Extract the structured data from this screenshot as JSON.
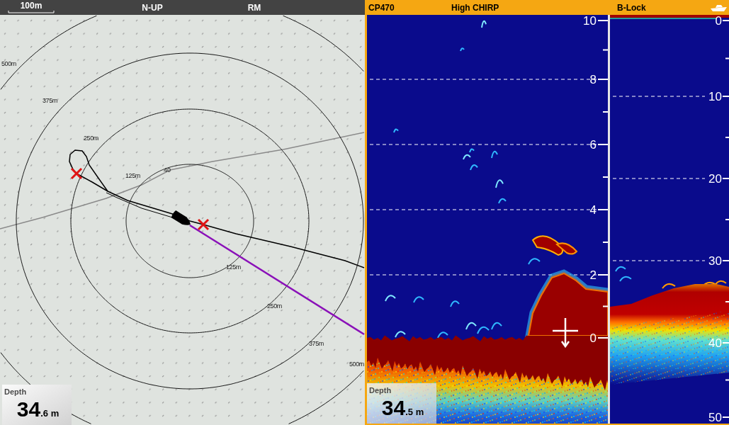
{
  "chart_pane": {
    "header": {
      "scale": "100m",
      "orientation": "N-UP",
      "motion": "RM"
    },
    "ring_labels_upper_left": [
      "500m",
      "375m",
      "250m",
      "125m"
    ],
    "contour_label": "40",
    "ring_labels_lower_right": [
      "125m",
      "250m",
      "375m",
      "500m"
    ],
    "depth_box": {
      "label": "Depth",
      "whole": "34",
      "fraction": ".6",
      "unit": "m"
    }
  },
  "sonar_pane": {
    "header": {
      "transducer": "CP470",
      "frequency": "High CHIRP",
      "mode": "B-Lock"
    },
    "main_scale": [
      "10",
      "8",
      "6",
      "4",
      "2",
      "0"
    ],
    "bottom_lock_scale": [
      "0",
      "10",
      "20",
      "30",
      "40",
      "50"
    ],
    "depth_box": {
      "label": "Depth",
      "whole": "34",
      "fraction": ".5",
      "unit": "m"
    }
  }
}
